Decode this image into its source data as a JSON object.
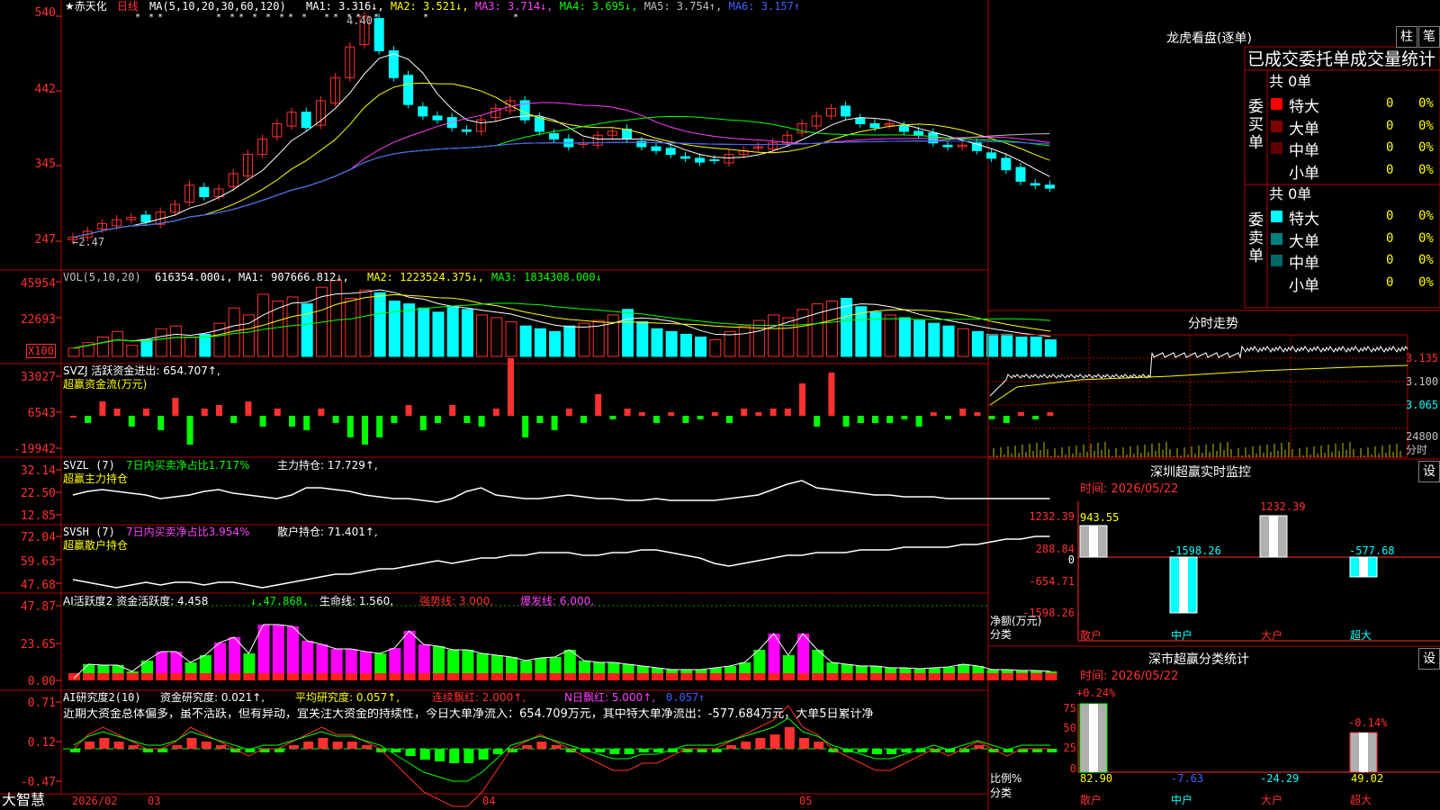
{
  "stock": {
    "name": "★赤天化",
    "period": "日线"
  },
  "main": {
    "ma_label": "MA(5,10,20,30,60,120)",
    "ma_values": [
      {
        "label": "MA1: 3.316↓,",
        "color": "#ffffff"
      },
      {
        "label": "MA2: 3.521↓,",
        "color": "#ffff00"
      },
      {
        "label": "MA3: 3.714↓,",
        "color": "#ff40ff"
      },
      {
        "label": "MA4: 3.695↓,",
        "color": "#00ff00"
      },
      {
        "label": "MA5: 3.754↑,",
        "color": "#c0c0c0"
      },
      {
        "label": "MA6: 3.157↑",
        "color": "#4060ff"
      }
    ],
    "y_ticks": [
      "540",
      "442",
      "345",
      "247"
    ],
    "high_mark": "4.40",
    "low_mark": "←2.47"
  },
  "vol": {
    "label": "VOL(5,10,20)",
    "value": "616354.000↓,",
    "ma1": "MA1: 907666.812↓,",
    "ma2": "MA2: 1223524.375↓,",
    "ma3": "MA3: 1834308.000↓",
    "y_ticks": [
      "45954",
      "22693"
    ],
    "unit": "X100"
  },
  "svzj": {
    "label": "SVZJ  活跃资金进出: 654.707↑,",
    "sub": "超赢资金流(万元)",
    "y_ticks": [
      "33027",
      "6543",
      "-19942"
    ]
  },
  "svzl": {
    "label": "SVZL (7)",
    "ratio": "7日内买卖净占比1.717%",
    "hold": "主力持仓: 17.729↑,",
    "sub": "超赢主力持仓",
    "y_ticks": [
      "32.14",
      "22.50",
      "12.85"
    ]
  },
  "svsh": {
    "label": "SVSH (7)",
    "ratio": "7日内买卖净占比3.954%",
    "hold": "散户持仓: 71.401↑,",
    "sub": "超赢散户持仓",
    "y_ticks": [
      "72.04",
      "59.63",
      "47.68"
    ]
  },
  "ai1": {
    "label": "AI活跃度2 资金活跃度: 4.458",
    "v2": "↓,47.868,",
    "life": "生命线: 1.560,",
    "strong": "强势线: 3.000,",
    "burst": "爆发线: 6.000,",
    "y_ticks": [
      "47.87",
      "23.65",
      "0.00"
    ]
  },
  "ai2": {
    "label": "AI研究度2(10)",
    "research": "资金研究度: 0.021↑,",
    "avg": "平均研究度: 0.057↑,",
    "cont": "连续飘红: 2.000↑,",
    "nred": "N日飘红: 5.000↑,",
    "last": "0.057↑",
    "y_ticks": [
      "0.71",
      "0.12",
      "-0.47"
    ],
    "comment": "近期大资金总体偏多，虽不活跃，但有异动，宜关注大资金的持续性，今日大单净流入：654.709万元，其中特大单净流出：-577.684万元，大单5日累计净"
  },
  "footer": {
    "brand": "大智慧",
    "dates": [
      "2026/02",
      "03",
      "04",
      "05"
    ]
  },
  "lhb": {
    "title": "龙虎看盘(逐单)",
    "btn1": "柱",
    "btn2": "笔",
    "header": "已成交委托单成交量统计",
    "buy_group": "委买单",
    "sell_group": "委卖单",
    "buy_total": "共 0单",
    "sell_total": "共 0单",
    "buy_rows": [
      {
        "name": "特大",
        "qty": "0",
        "pct": "0%",
        "color": "#ff0000"
      },
      {
        "name": "大单",
        "qty": "0",
        "pct": "0%",
        "color": "#800000"
      },
      {
        "name": "中单",
        "qty": "0",
        "pct": "0%",
        "color": "#600000"
      },
      {
        "name": "小单",
        "qty": "0",
        "pct": "0%",
        "color": "#000000"
      }
    ],
    "sell_rows": [
      {
        "name": "特大",
        "qty": "0",
        "pct": "0%",
        "color": "#00ffff"
      },
      {
        "name": "大单",
        "qty": "0",
        "pct": "0%",
        "color": "#008080"
      },
      {
        "name": "中单",
        "qty": "0",
        "pct": "0%",
        "color": "#006868"
      },
      {
        "name": "小单",
        "qty": "0",
        "pct": "0%",
        "color": "#000000"
      }
    ]
  },
  "fenshi": {
    "title": "分时走势",
    "prices": [
      "3.135",
      "3.100",
      "3.065"
    ],
    "vol": "24800",
    "vol_label": "分时"
  },
  "monitor": {
    "title": "深圳超赢实时监控",
    "btn": "设",
    "time": "时间: 2026/05/22",
    "y_ticks": [
      "1232.39",
      "288.84",
      "0",
      "-654.71",
      "-1598.26"
    ],
    "y_label": "净额(万元)",
    "x_label": "分类",
    "categories": [
      "散户",
      "中户",
      "大户",
      "超大"
    ],
    "values": [
      "943.55",
      "-1598.26",
      "1232.39",
      "-577.68"
    ]
  },
  "classify": {
    "title": "深市超赢分类统计",
    "btn": "设",
    "time": "时间: 2026/05/22",
    "y_ticks": [
      "75",
      "50",
      "25",
      "0"
    ],
    "y_label": "比例%",
    "x_label": "分类",
    "categories": [
      "散户",
      "中户",
      "大户",
      "超大"
    ],
    "values": [
      "82.90",
      "-7.63",
      "-24.29",
      "49.02"
    ],
    "top_labels": [
      "+0.24%",
      "-0.14%"
    ]
  },
  "chart_data": [
    {
      "type": "candlestick",
      "title": "赤天化 日线",
      "y_range": [
        2.47,
        5.4
      ],
      "series_close": [
        2.52,
        2.6,
        2.7,
        2.75,
        2.78,
        2.72,
        2.85,
        2.95,
        3.2,
        3.05,
        3.15,
        3.35,
        3.6,
        3.8,
        4.0,
        4.15,
        3.95,
        4.3,
        4.6,
        5.0,
        5.4,
        4.95,
        4.6,
        4.25,
        4.1,
        4.05,
        3.95,
        3.9,
        4.05,
        4.2,
        4.3,
        4.05,
        3.9,
        3.8,
        3.7,
        3.75,
        3.85,
        3.9,
        3.8,
        3.7,
        3.65,
        3.6,
        3.55,
        3.5,
        3.52,
        3.6,
        3.65,
        3.7,
        3.75,
        3.85,
        4.0,
        4.1,
        4.2,
        4.1,
        4.0,
        3.95,
        4.0,
        3.9,
        3.85,
        3.75,
        3.7,
        3.72,
        3.65,
        3.55,
        3.4,
        3.25,
        3.2,
        3.16
      ]
    },
    {
      "type": "bar",
      "title": "深圳超赢实时监控",
      "categories": [
        "散户",
        "中户",
        "大户",
        "超大"
      ],
      "values": [
        943.55,
        -1598.26,
        1232.39,
        -577.68
      ],
      "ylim": [
        -1598.26,
        1232.39
      ],
      "ylabel": "净额(万元)"
    },
    {
      "type": "bar",
      "title": "深市超赢分类统计",
      "categories": [
        "散户",
        "中户",
        "大户",
        "超大"
      ],
      "values": [
        82.9,
        -7.63,
        -24.29,
        49.02
      ],
      "ylim": [
        0,
        80
      ],
      "ylabel": "比例%"
    }
  ]
}
